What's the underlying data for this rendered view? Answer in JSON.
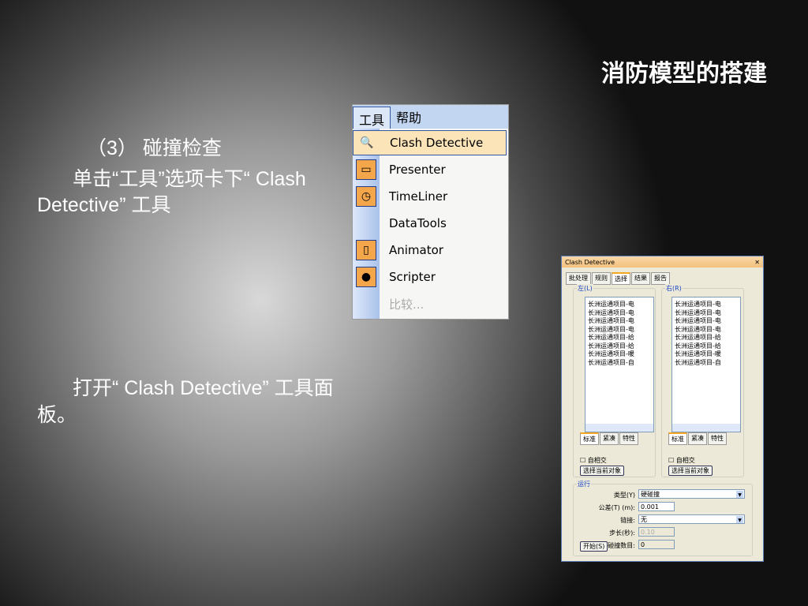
{
  "slide": {
    "title": "消防模型的搭建",
    "step": "（3） 碰撞检查",
    "para1_line1": "单击“工具”选项卡下“ Clash",
    "para1_line2": "Detective” 工具",
    "para2_line1": "打开“ Clash Detective” 工具面",
    "para2_line2": "板。"
  },
  "menu": {
    "bar": [
      "工具",
      "帮助"
    ],
    "items": [
      {
        "label": "Clash Detective",
        "icon": "clash-icon"
      },
      {
        "label": "Presenter",
        "icon": "presenter-icon"
      },
      {
        "label": "TimeLiner",
        "icon": "clock-icon"
      },
      {
        "label": "DataTools",
        "icon": ""
      },
      {
        "label": "Animator",
        "icon": "animator-icon"
      },
      {
        "label": "Scripter",
        "icon": "scripter-icon"
      },
      {
        "label": "比较...",
        "icon": ""
      }
    ]
  },
  "panel": {
    "title": "Clash Detective",
    "tabs": [
      "批处理",
      "规则",
      "选择",
      "结果",
      "报告"
    ],
    "left_label": "左(L)",
    "right_label": "右(R)",
    "tree_items": [
      "长洲运通项目-电",
      "长洲运通项目-电",
      "长洲运通项目-电",
      "长洲运通项目-电",
      "长洲运通项目-给",
      "长洲运通项目-给",
      "长洲运通项目-暖",
      "长洲运通项目-自"
    ],
    "subtabs": [
      "标准",
      "紧凑",
      "特性"
    ],
    "self_intersect": "自相交",
    "select_current": "选择当前对象",
    "run": {
      "label": "运行",
      "type_label": "类型(Y)",
      "type_value": "硬碰撞",
      "tol_label": "公差(T) (m):",
      "tol_value": "0.001",
      "link_label": "链接:",
      "link_value": "无",
      "step_label": "步长(秒):",
      "step_value": "0.10",
      "start": "开始(S)",
      "count_label": "碰撞数目:",
      "count_value": "0"
    }
  }
}
